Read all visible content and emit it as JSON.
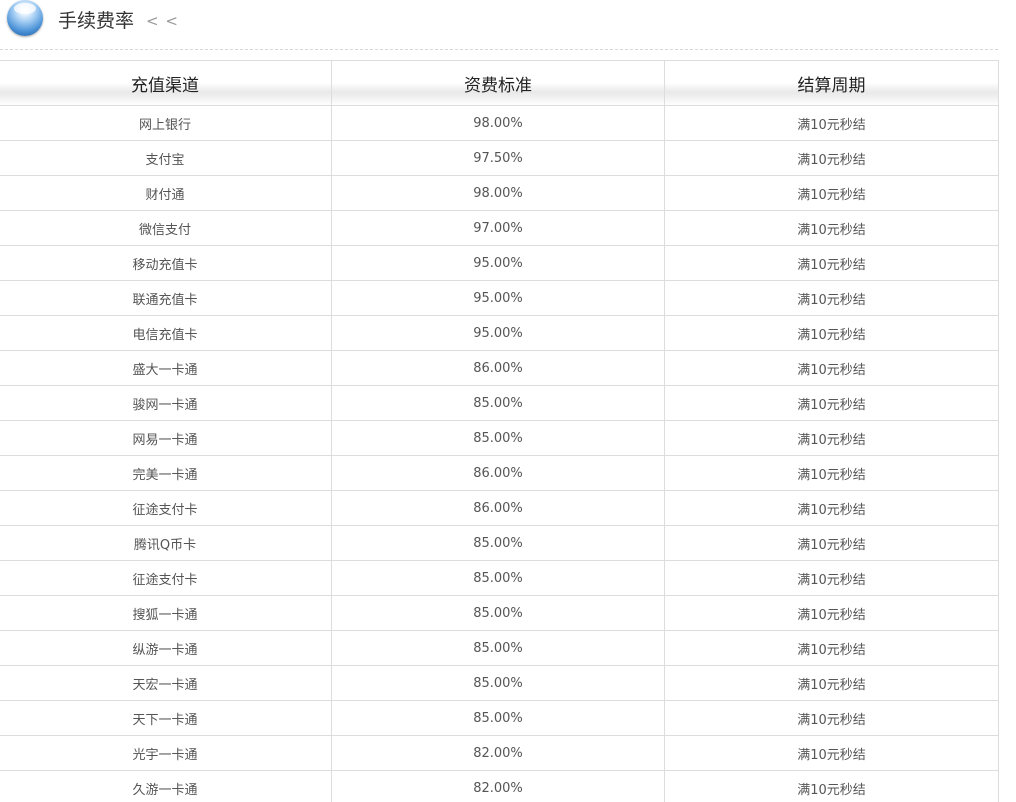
{
  "header": {
    "title": "手续费率",
    "back_text": "< <"
  },
  "table": {
    "columns": [
      "充值渠道",
      "资费标准",
      "结算周期"
    ],
    "rows": [
      {
        "channel": "网上银行",
        "rate": "98.00%",
        "settle": "满10元秒结"
      },
      {
        "channel": "支付宝",
        "rate": "97.50%",
        "settle": "满10元秒结"
      },
      {
        "channel": "财付通",
        "rate": "98.00%",
        "settle": "满10元秒结"
      },
      {
        "channel": "微信支付",
        "rate": "97.00%",
        "settle": "满10元秒结"
      },
      {
        "channel": "移动充值卡",
        "rate": "95.00%",
        "settle": "满10元秒结"
      },
      {
        "channel": "联通充值卡",
        "rate": "95.00%",
        "settle": "满10元秒结"
      },
      {
        "channel": "电信充值卡",
        "rate": "95.00%",
        "settle": "满10元秒结"
      },
      {
        "channel": "盛大一卡通",
        "rate": "86.00%",
        "settle": "满10元秒结"
      },
      {
        "channel": "骏网一卡通",
        "rate": "85.00%",
        "settle": "满10元秒结"
      },
      {
        "channel": "网易一卡通",
        "rate": "85.00%",
        "settle": "满10元秒结"
      },
      {
        "channel": "完美一卡通",
        "rate": "86.00%",
        "settle": "满10元秒结"
      },
      {
        "channel": "征途支付卡",
        "rate": "86.00%",
        "settle": "满10元秒结"
      },
      {
        "channel": "腾讯Q币卡",
        "rate": "85.00%",
        "settle": "满10元秒结"
      },
      {
        "channel": "征途支付卡",
        "rate": "85.00%",
        "settle": "满10元秒结"
      },
      {
        "channel": "搜狐一卡通",
        "rate": "85.00%",
        "settle": "满10元秒结"
      },
      {
        "channel": "纵游一卡通",
        "rate": "85.00%",
        "settle": "满10元秒结"
      },
      {
        "channel": "天宏一卡通",
        "rate": "85.00%",
        "settle": "满10元秒结"
      },
      {
        "channel": "天下一卡通",
        "rate": "85.00%",
        "settle": "满10元秒结"
      },
      {
        "channel": "光宇一卡通",
        "rate": "82.00%",
        "settle": "满10元秒结"
      },
      {
        "channel": "久游一卡通",
        "rate": "82.00%",
        "settle": "满10元秒结"
      }
    ]
  }
}
